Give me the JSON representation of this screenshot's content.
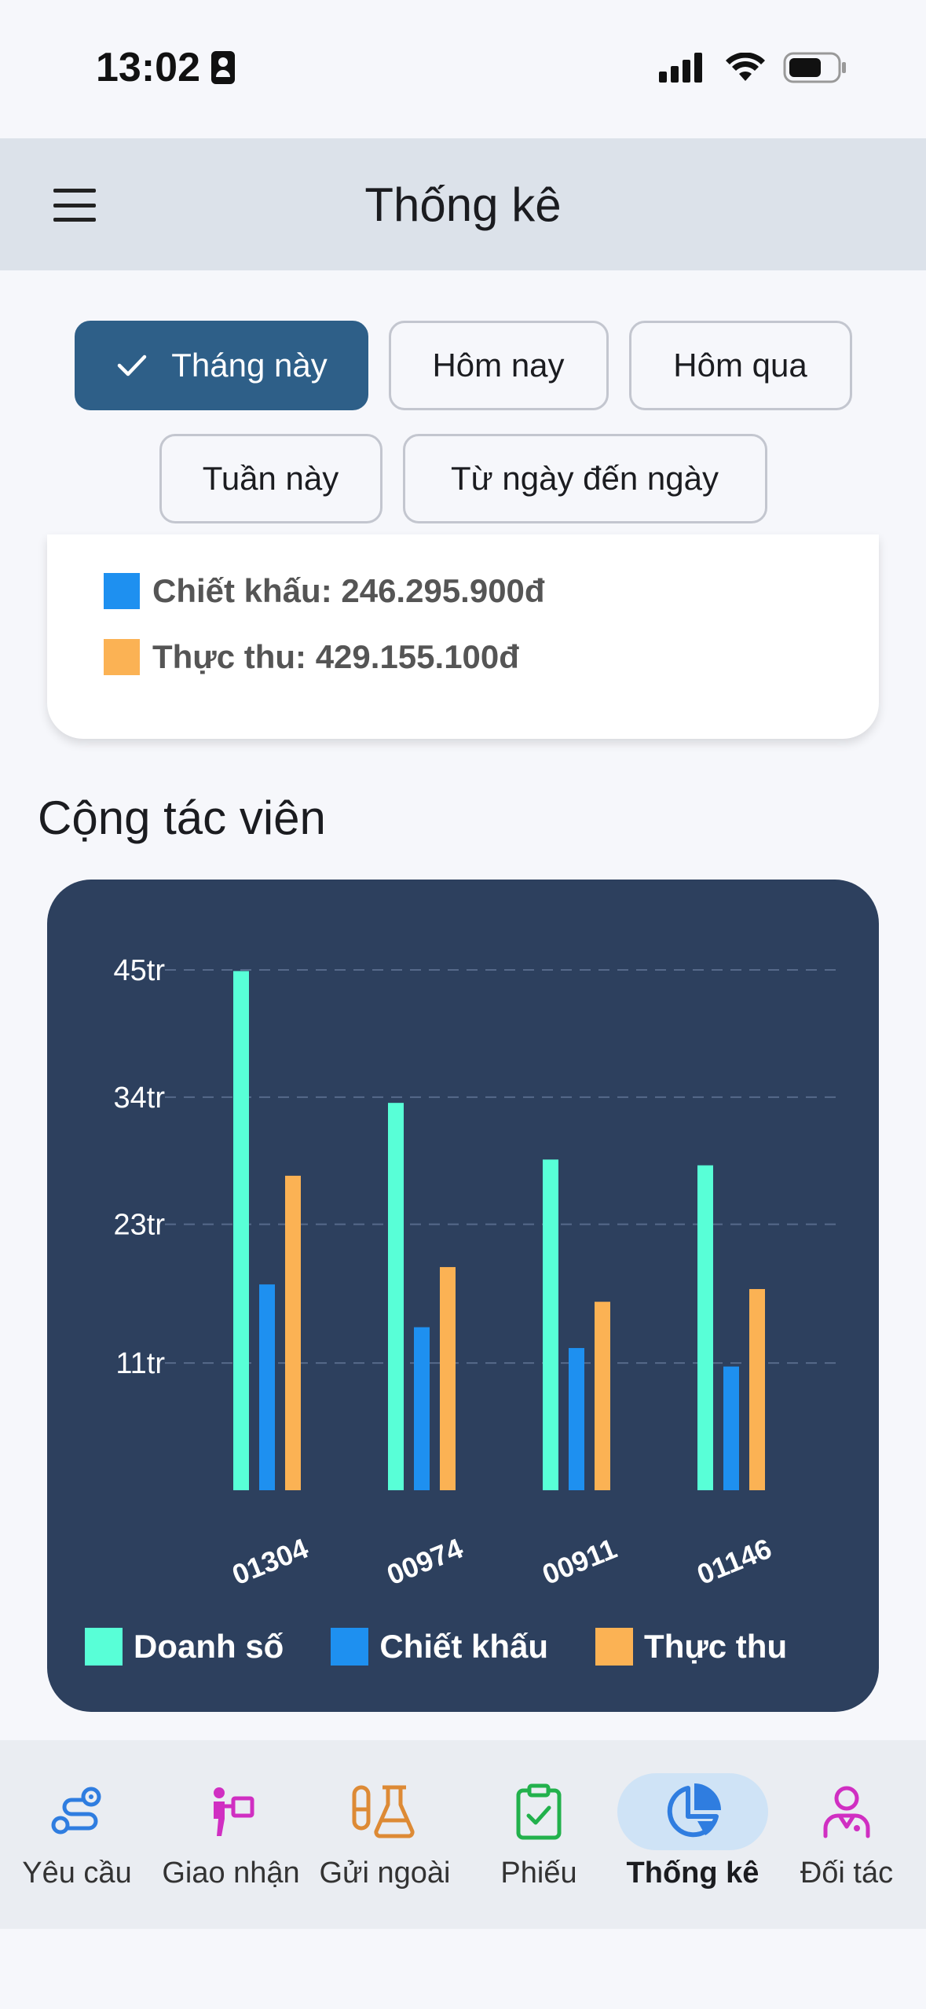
{
  "status_bar": {
    "time": "13:02"
  },
  "app_bar": {
    "title": "Thống kê"
  },
  "filters": {
    "row1": [
      {
        "label": "Tháng này",
        "selected": true
      },
      {
        "label": "Hôm nay",
        "selected": false
      },
      {
        "label": "Hôm qua",
        "selected": false
      }
    ],
    "row2": [
      {
        "label": "Tuần này",
        "selected": false
      },
      {
        "label": "Từ ngày đến ngày",
        "selected": false
      }
    ]
  },
  "summary": {
    "discount": "Chiết khấu: 246.295.900đ",
    "actual": "Thực thu: 429.155.100đ"
  },
  "section_title": "Cộng tác viên",
  "colors": {
    "revenue": "#58ffd7",
    "discount": "#1e90f0",
    "actual": "#fbb254",
    "chart_bg": "#2d405e",
    "selected_chip": "#2e5f88"
  },
  "chart_data": {
    "type": "bar",
    "categories": [
      "01304",
      "00974",
      "00911",
      "01146"
    ],
    "series": [
      {
        "name": "Doanh số",
        "values": [
          44.9,
          33.5,
          28.6,
          28.1
        ]
      },
      {
        "name": "Chiết khấu",
        "values": [
          17.8,
          14.1,
          12.3,
          10.7
        ]
      },
      {
        "name": "Thực thu",
        "values": [
          27.2,
          19.3,
          16.3,
          17.4
        ]
      }
    ],
    "yticks": [
      "45tr",
      "34tr",
      "23tr",
      "11tr"
    ],
    "ytick_values": [
      45,
      34,
      23,
      11
    ],
    "ylim": [
      0,
      45
    ],
    "grid": true,
    "legend": "bottom"
  },
  "bottom_nav": [
    {
      "label": "Yêu cầu",
      "icon": "route-icon",
      "active": false
    },
    {
      "label": "Giao nhận",
      "icon": "delivery-person-icon",
      "active": false
    },
    {
      "label": "Gửi ngoài",
      "icon": "lab-flask-icon",
      "active": false
    },
    {
      "label": "Phiếu",
      "icon": "clipboard-check-icon",
      "active": false
    },
    {
      "label": "Thống kê",
      "icon": "pie-chart-icon",
      "active": true
    },
    {
      "label": "Đối tác",
      "icon": "partner-icon",
      "active": false
    }
  ]
}
